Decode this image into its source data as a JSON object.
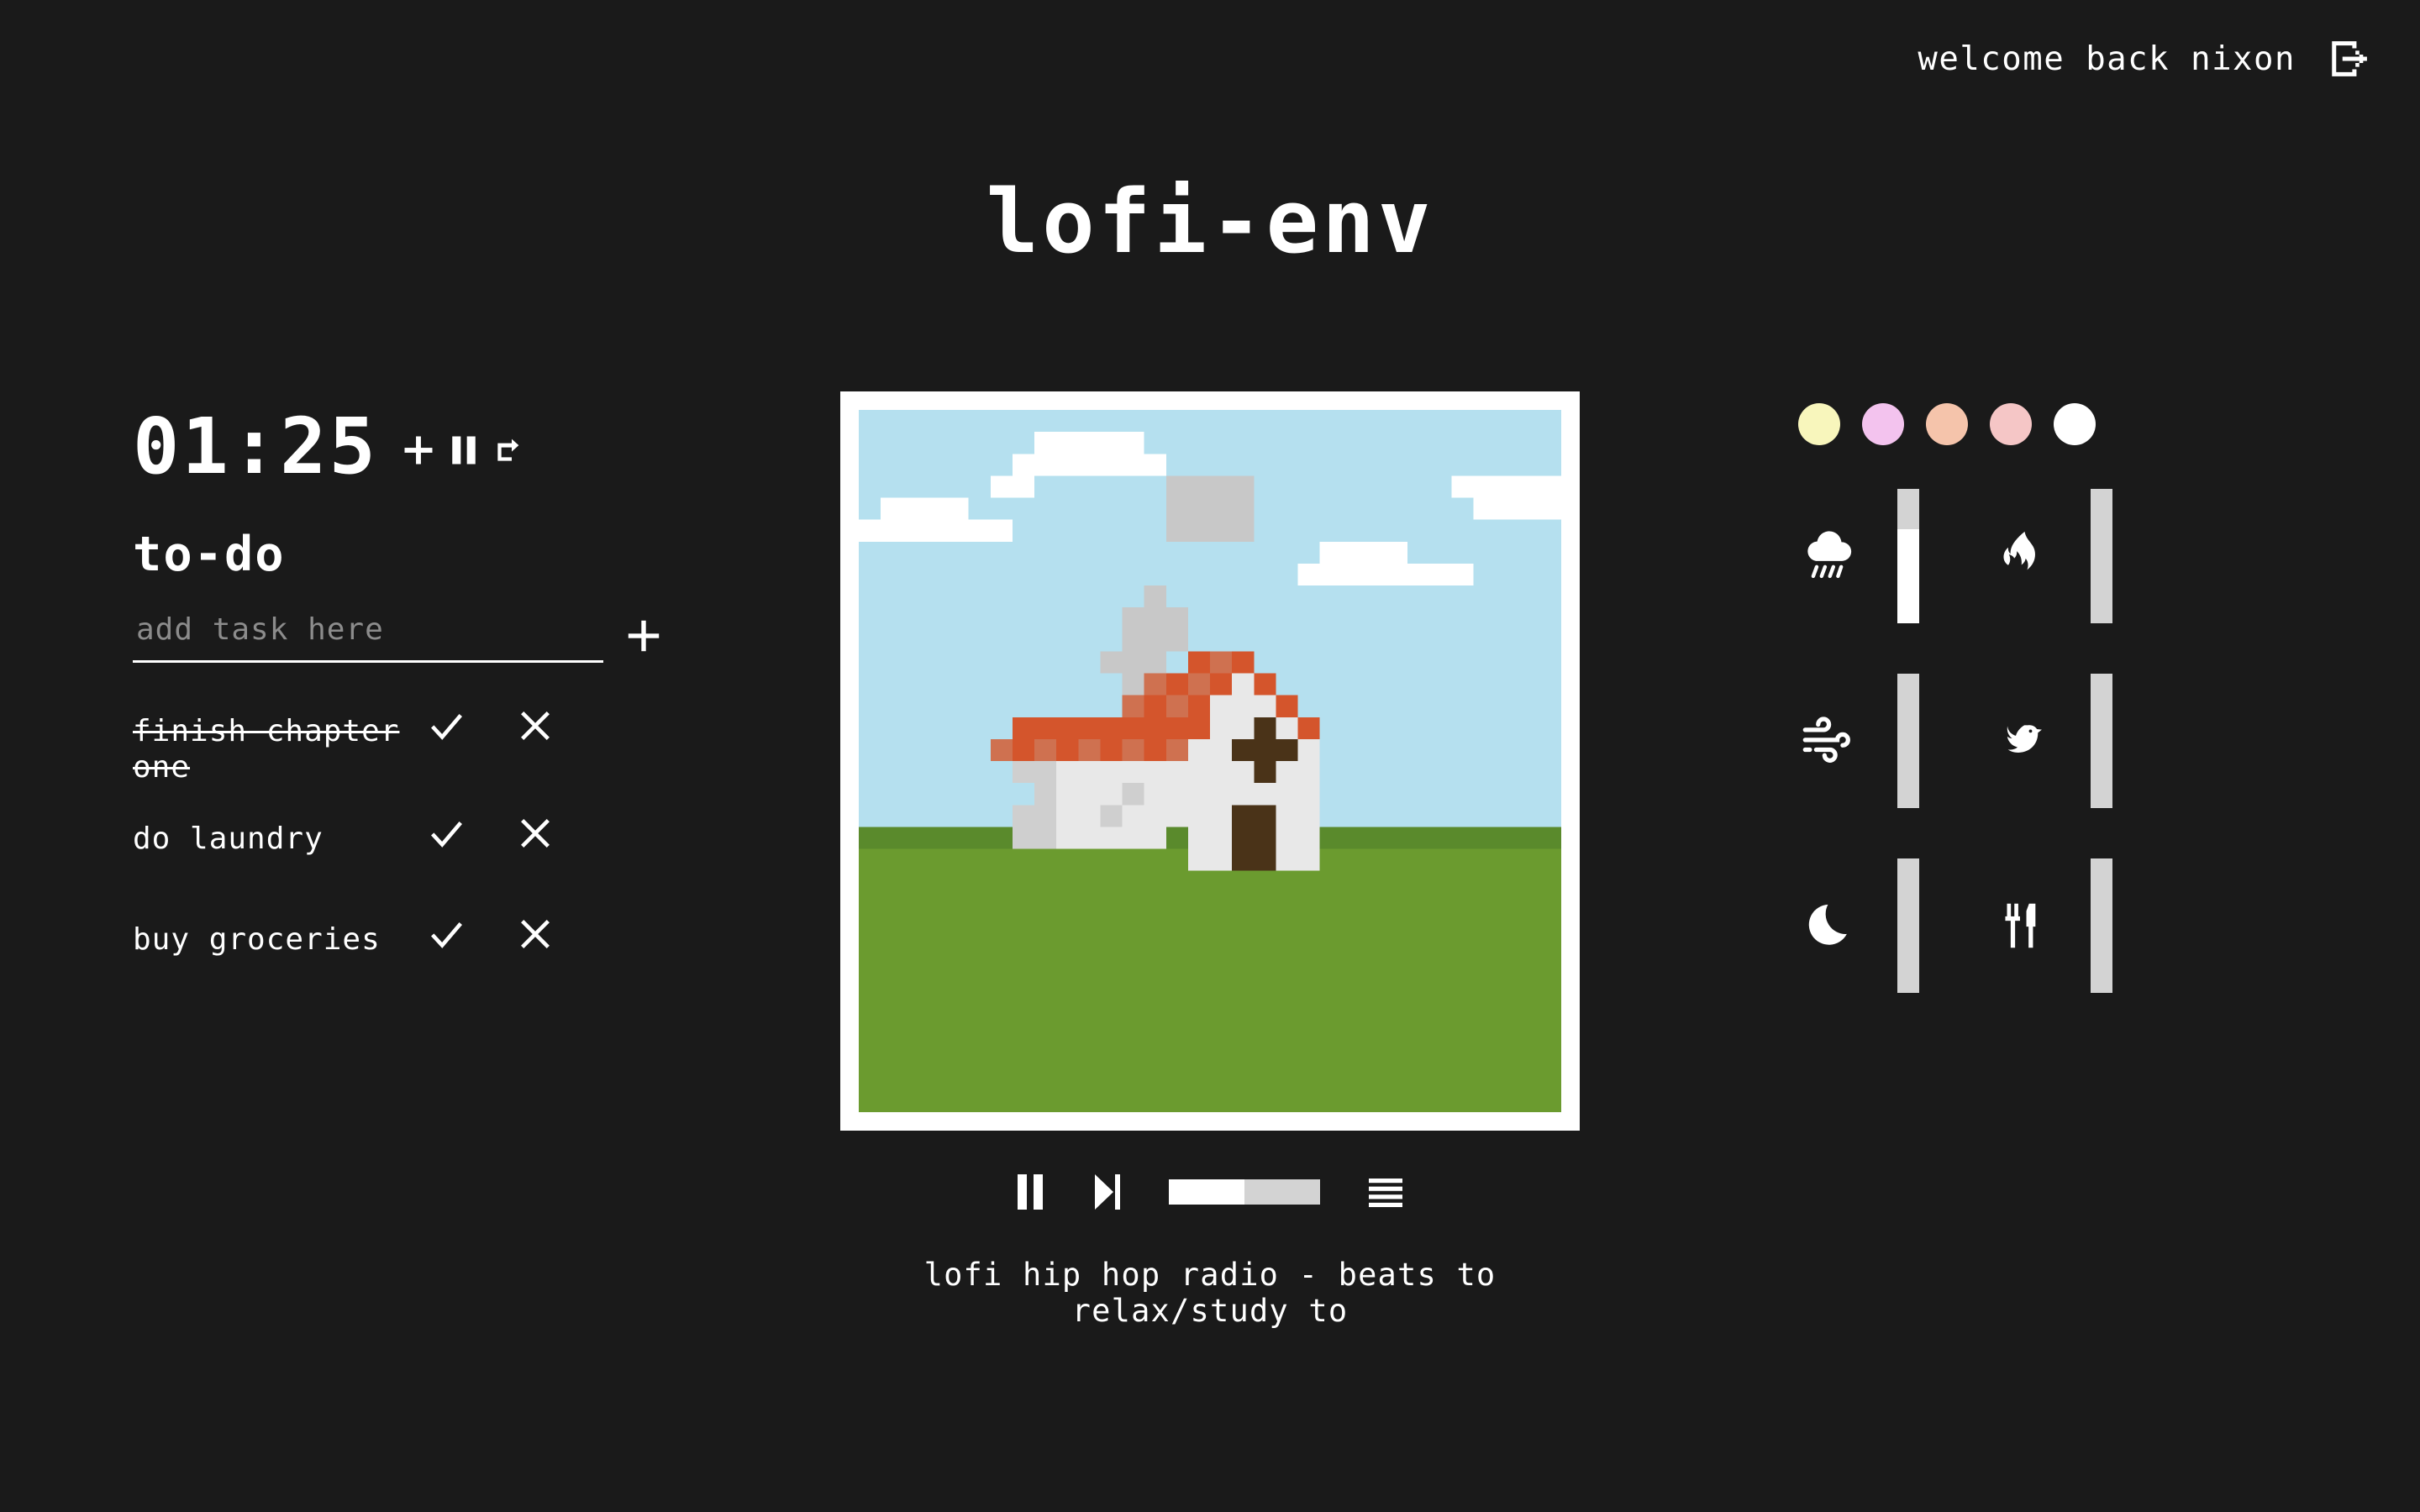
{
  "header": {
    "welcome_text": "welcome back nixon",
    "logout_icon": "logout-icon"
  },
  "app": {
    "title": "lofi-env",
    "background_color": "#1a1a1a",
    "text_color": "#ffffff"
  },
  "timer": {
    "display": "01:25",
    "add_label": "+",
    "pause_label": "pause",
    "reset_label": "reset"
  },
  "todo": {
    "heading": "to-do",
    "input_value": "",
    "input_placeholder": "add task here",
    "add_button_label": "+",
    "items": [
      {
        "label": "finish chapter one",
        "done": true,
        "complete_label": "complete",
        "delete_label": "delete"
      },
      {
        "label": "do laundry",
        "done": false,
        "complete_label": "complete",
        "delete_label": "delete"
      },
      {
        "label": "buy groceries",
        "done": false,
        "complete_label": "complete",
        "delete_label": "delete"
      }
    ]
  },
  "player": {
    "track_title": "lofi hip hop radio - beats to relax/study to",
    "play_state": "playing",
    "pause_label": "pause",
    "next_label": "next",
    "playlist_label": "playlist",
    "volume_percent": 50,
    "album_art": {
      "alt": "pixel art church on a green hill",
      "sky_color": "#b5e0ef",
      "cloud_color": "#ffffff",
      "smoke_color": "#c8c8c8",
      "roof_color_a": "#d4552c",
      "roof_color_b": "#cf7150",
      "wall_color": "#e8e8e8",
      "wall_shadow_color": "#cfcfcf",
      "trim_color": "#4a3318",
      "hill_color": "#6b9b2f",
      "hill_edge_color": "#5a8a2c",
      "frame_color": "#ffffff"
    }
  },
  "themes": {
    "swatches": [
      {
        "name": "cream",
        "color": "#f8f6bc"
      },
      {
        "name": "lilac",
        "color": "#f3c3ee"
      },
      {
        "name": "peach",
        "color": "#f5c4ab"
      },
      {
        "name": "blush",
        "color": "#f5c6c6"
      },
      {
        "name": "white",
        "color": "#ffffff"
      }
    ]
  },
  "ambience": {
    "sounds": [
      {
        "name": "rain",
        "icon": "rain-cloud-icon",
        "volume_percent": 70
      },
      {
        "name": "fire",
        "icon": "flame-icon",
        "volume_percent": 0
      },
      {
        "name": "wind",
        "icon": "wind-icon",
        "volume_percent": 0
      },
      {
        "name": "birds",
        "icon": "bird-icon",
        "volume_percent": 0
      },
      {
        "name": "night",
        "icon": "moon-icon",
        "volume_percent": 0
      },
      {
        "name": "cafe",
        "icon": "utensils-icon",
        "volume_percent": 0
      }
    ]
  }
}
